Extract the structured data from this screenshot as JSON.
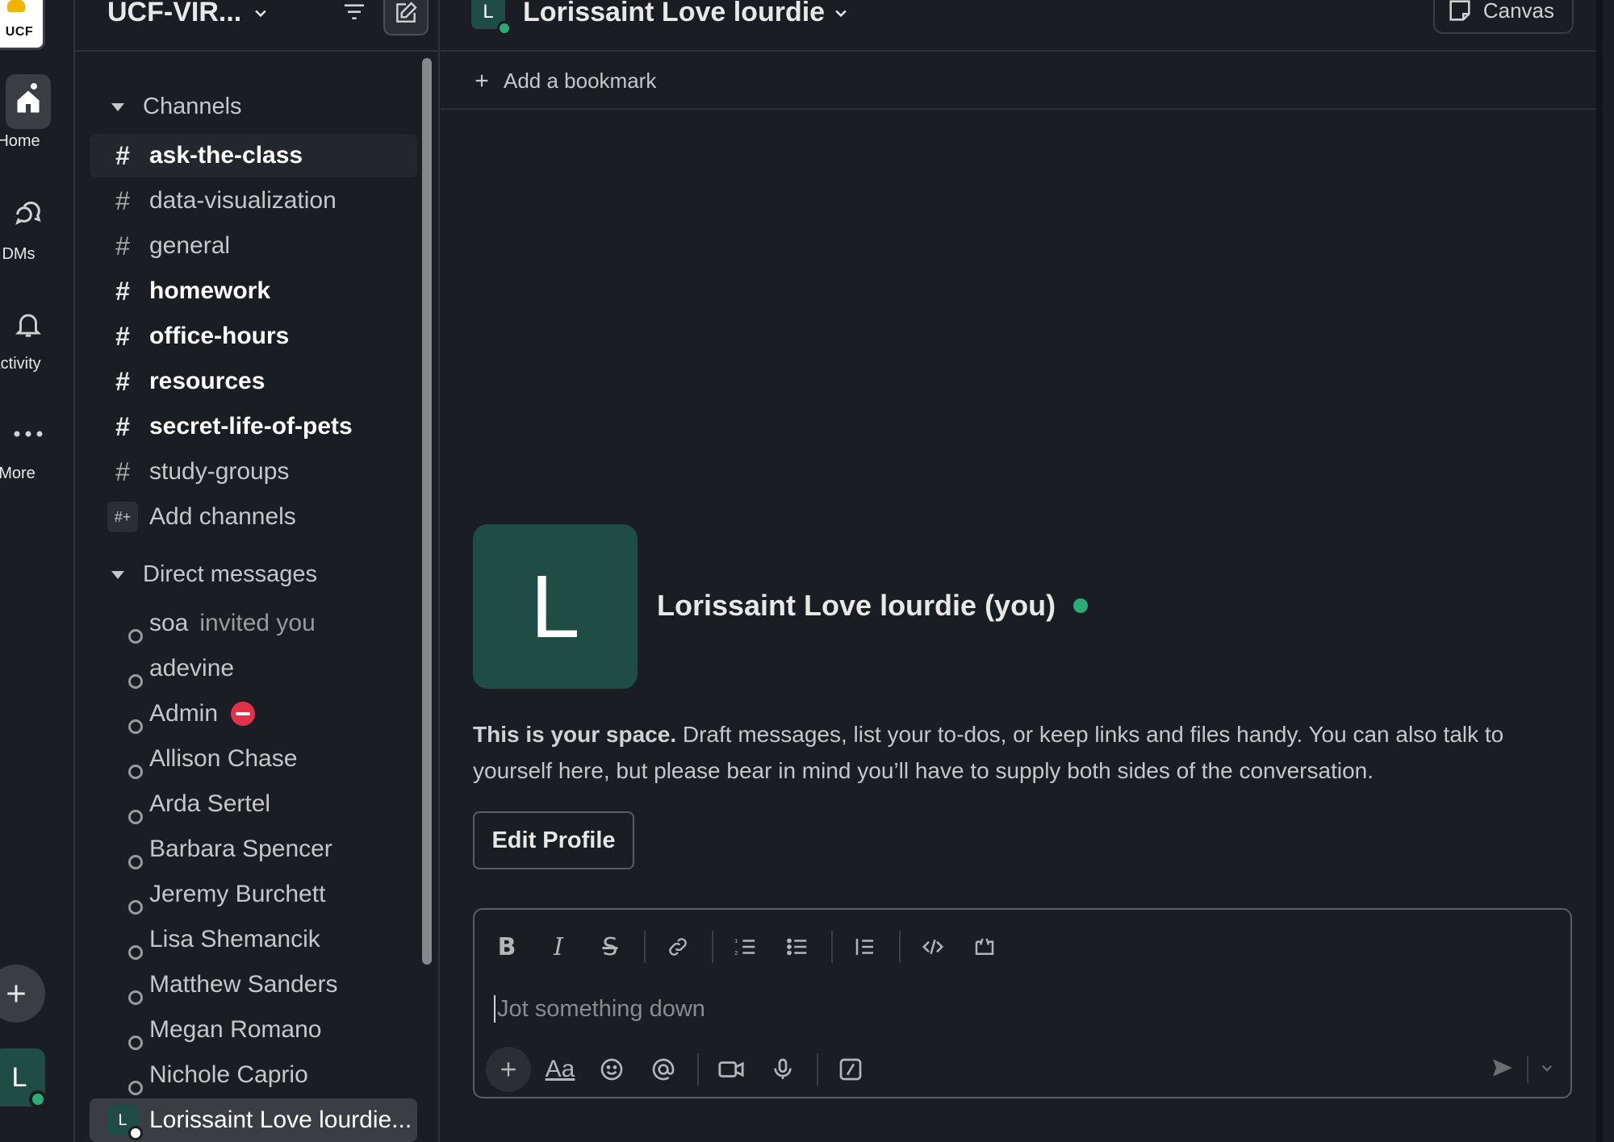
{
  "workspace": {
    "logo_text": "UCF",
    "name": "UCF-VIR..."
  },
  "rail": {
    "home_label": "Home",
    "dms_label": "DMs",
    "activity_label": "Activity",
    "more_label": "More",
    "user_initial": "L"
  },
  "sidebar": {
    "channels_header": "Channels",
    "channels": [
      {
        "name": "ask-the-class",
        "unread": true
      },
      {
        "name": "data-visualization",
        "unread": false
      },
      {
        "name": "general",
        "unread": false
      },
      {
        "name": "homework",
        "unread": true
      },
      {
        "name": "office-hours",
        "unread": true
      },
      {
        "name": "resources",
        "unread": true
      },
      {
        "name": "secret-life-of-pets",
        "unread": true
      },
      {
        "name": "study-groups",
        "unread": false
      }
    ],
    "add_channels_label": "Add channels",
    "dms_header": "Direct messages",
    "dms": [
      {
        "name": "soa",
        "note": "invited you"
      },
      {
        "name": "adevine"
      },
      {
        "name": "Admin"
      },
      {
        "name": "Allison Chase"
      },
      {
        "name": "Arda Sertel"
      },
      {
        "name": "Barbara Spencer"
      },
      {
        "name": "Jeremy Burchett"
      },
      {
        "name": "Lisa Shemancik"
      },
      {
        "name": "Matthew Sanders"
      },
      {
        "name": "Megan Romano"
      },
      {
        "name": "Nichole Caprio"
      },
      {
        "name": "Lorissaint Love lourdie..."
      }
    ]
  },
  "header": {
    "avatar_initial": "L",
    "title": "Lorissaint Love lourdie",
    "canvas_label": "Canvas",
    "bookmark_label": "Add a bookmark"
  },
  "intro": {
    "avatar_initial": "L",
    "name": "Lorissaint Love lourdie (you)",
    "lead": "This is your space.",
    "body": " Draft messages, list your to-dos, or keep links and files handy. You can also talk to yourself here, but please bear in mind you’ll have to supply both sides of the conversation.",
    "edit_profile_label": "Edit Profile"
  },
  "composer": {
    "placeholder": "Jot something down",
    "format_label": "Aa"
  },
  "colors": {
    "background": "#1a1d21",
    "accent_green": "#2bac76",
    "avatar_teal": "#1f4d43",
    "dnd_red": "#e0324c"
  }
}
